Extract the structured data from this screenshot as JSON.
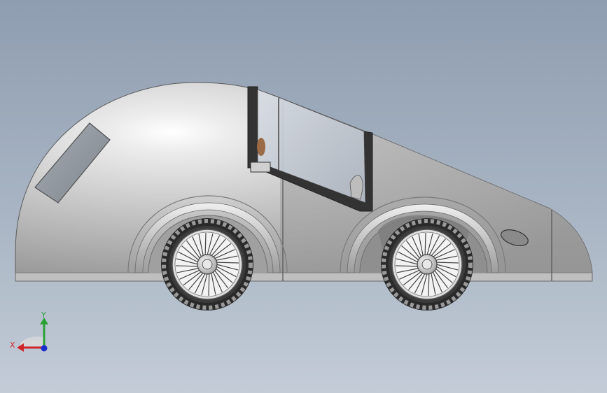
{
  "viewport": {
    "background_top": "#8e9db0",
    "background_bottom": "#c3ccd7"
  },
  "model": {
    "body_color": "#c8c8c8",
    "glass_color": "#c4cbd4",
    "frame_color": "#3a3a3a",
    "tire_color": "#2a2a2a"
  },
  "triad": {
    "x_label": "X",
    "y_label": "Y",
    "x_color": "#d0262a",
    "y_color": "#2aa136",
    "z_color": "#1b2fcf"
  }
}
